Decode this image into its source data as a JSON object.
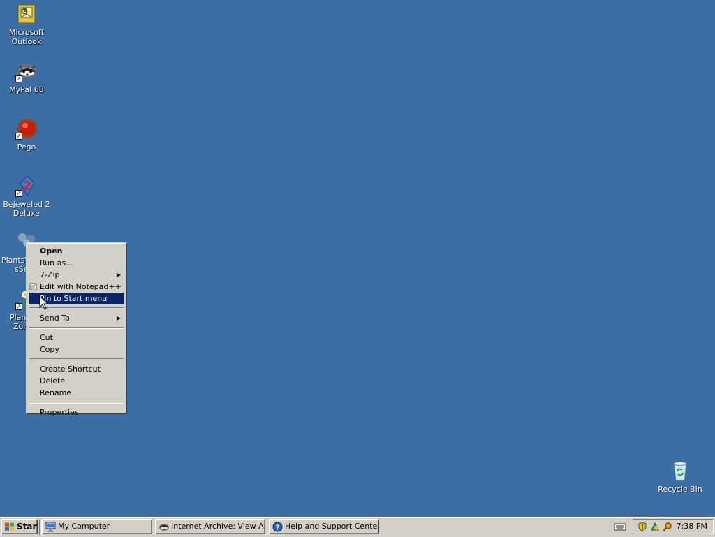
{
  "desktop": {
    "icons": [
      {
        "label_line1": "Microsoft",
        "label_line2": "Outlook",
        "icon": "outlook-icon"
      },
      {
        "label_line1": "MyPal 68",
        "label_line2": "",
        "icon": "mypal-icon"
      },
      {
        "label_line1": "Pego",
        "label_line2": "",
        "icon": "pego-icon"
      },
      {
        "label_line1": "Bejeweled 2",
        "label_line2": "Deluxe",
        "icon": "bejeweled-icon"
      },
      {
        "label_line1": "PlantsV",
        "label_line2": "sSe",
        "icon": "plants-vs-zombies-icon"
      },
      {
        "label_line1": "Plan",
        "label_line2": "Zom",
        "icon": "plants-vs-zombies-shortcut-icon"
      }
    ],
    "recycle_bin_label": "Recycle Bin"
  },
  "context_menu": {
    "items": {
      "open": "Open",
      "run_as": "Run as...",
      "seven_zip": "7-Zip",
      "edit_notepad": "Edit with Notepad++",
      "pin_start": "Pin to Start menu",
      "send_to": "Send To",
      "cut": "Cut",
      "copy": "Copy",
      "create_shortcut": "Create Shortcut",
      "delete": "Delete",
      "rename": "Rename",
      "properties": "Properties"
    },
    "highlighted": "Pin to Start menu"
  },
  "taskbar": {
    "start_label": "Start",
    "tasks": [
      {
        "label": "My Computer",
        "icon": "my-computer-icon"
      },
      {
        "label": "Internet Archive: View A...",
        "icon": "browser-icon"
      },
      {
        "label": "Help and Support Center",
        "icon": "help-icon"
      }
    ],
    "clock": "7:38 PM"
  },
  "colors": {
    "desktop_bg": "#3a6ea5",
    "menu_bg": "#d4d0c8",
    "highlight": "#0a246a"
  }
}
